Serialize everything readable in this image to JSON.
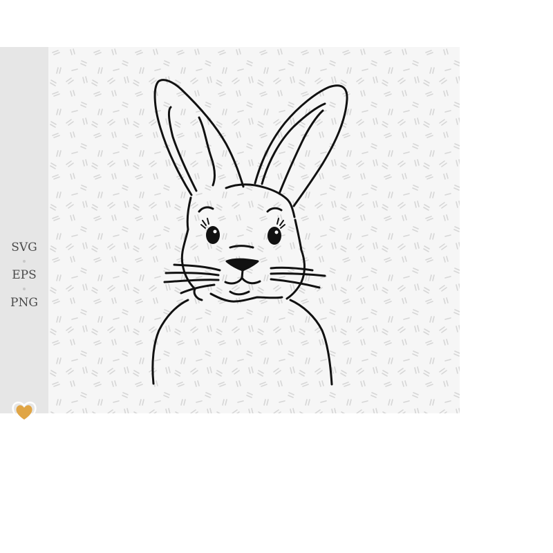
{
  "sidebar": {
    "formats": [
      "SVG",
      "EPS",
      "PNG"
    ],
    "logo_icon": "heart-icon",
    "accent_color": "#e0a545"
  },
  "artwork": {
    "subject": "bunny-line-art",
    "line_color": "#111111",
    "background_color": "#f6f6f6",
    "pattern_color": "#d6d6d6"
  }
}
